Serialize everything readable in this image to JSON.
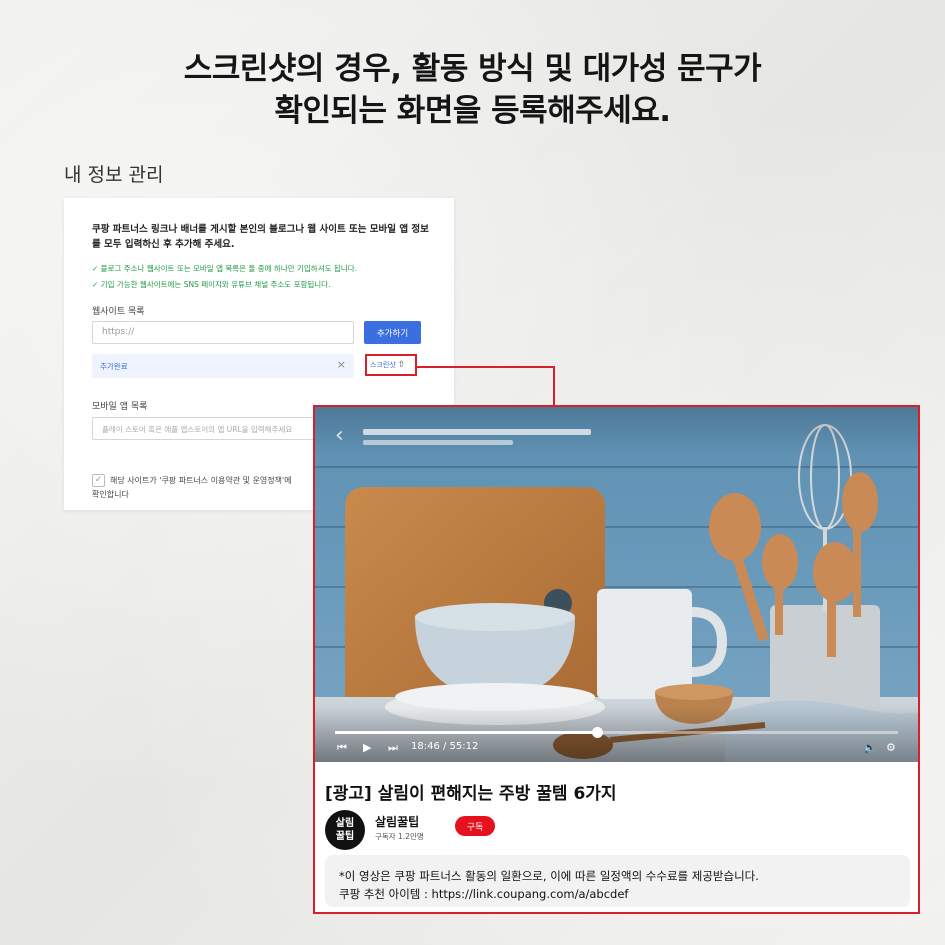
{
  "headline": {
    "line1": "스크린샷의 경우, 활동 방식 및 대가성 문구가",
    "line2": "확인되는 화면을 등록해주세요."
  },
  "form": {
    "title": "내 정보 관리",
    "intro": "쿠팡 파트너스 링크나 배너를 게시할 본인의 블로그나 웹 사이트 또는 모바일 앱 정보를 모두 입력하신 후 추가해 주세요.",
    "check1": "✓ 블로그 주소나 웹사이트 또는 모바일 앱 목록은 둘 중에 하나만 기입하셔도 됩니다.",
    "check2": "✓ 기입 가능한 웹사이트에는 SNS 페이지와 유튜브 채널 주소도 포함됩니다.",
    "website_label": "웹사이트 목록",
    "url_placeholder": "https://",
    "add_button": "추가하기",
    "added_text": "추가완료",
    "remove_icon": "×",
    "screenshot_button": "스크린샷",
    "upload_icon": "⇧",
    "app_label": "모바일 앱 목록",
    "app_placeholder": "플레이 스토어 혹은 애플 앱스토어의 앱 URL을 입력해주세요",
    "agree_text": "해당 사이트가 '쿠팡 파트너스 이용약관 및 운영정책'에",
    "agree_text2": "확인합니다"
  },
  "video": {
    "back_icon": "‹",
    "time": "18:46 / 55:12",
    "progress_fraction": 0.465,
    "title": "[광고] 살림이 편해지는 주방 꿀템 6가지",
    "avatar_line1": "살림",
    "avatar_line2": "꿀팁",
    "channel_name": "살림꿀팁",
    "subscribers": "구독자 1.2만명",
    "subscribe_button": "구독",
    "desc1": "*이 영상은 쿠팡 파트너스 활동의 일환으로, 이에 따른 일정액의 수수료를 제공받습니다.",
    "desc2": "쿠팡 추천 아이템 : https://link.coupang.com/a/abcdef",
    "controls": {
      "prev": "⏮",
      "play": "▶",
      "next": "⏭",
      "volume": "🔈",
      "settings": "⚙"
    }
  },
  "colors": {
    "accent_red": "#d8202c",
    "subscribe_red": "#e5121d",
    "link_blue": "#3b6fe0",
    "check_green": "#1e9b45"
  }
}
